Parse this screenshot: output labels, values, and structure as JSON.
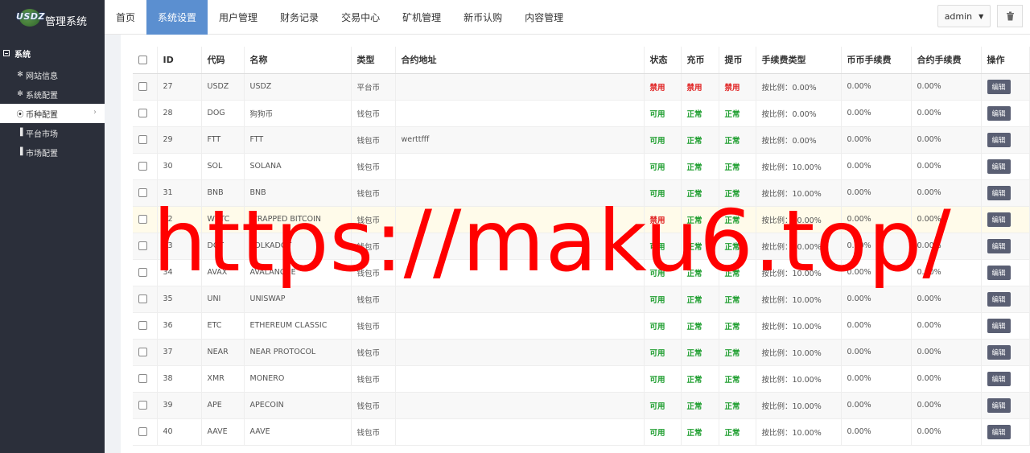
{
  "app": {
    "logo_text": "USDZ",
    "title": "管理系统"
  },
  "sidebar": {
    "group": "系统",
    "items": [
      {
        "label": "网站信息",
        "icon": "gear-icon"
      },
      {
        "label": "系统配置",
        "icon": "gear-icon"
      },
      {
        "label": "币种配置",
        "icon": "circle-dot-icon",
        "active": true
      },
      {
        "label": "平台市场",
        "icon": "bar-chart-icon"
      },
      {
        "label": "市场配置",
        "icon": "bar-chart-icon"
      }
    ]
  },
  "topnav": {
    "items": [
      {
        "label": "首页"
      },
      {
        "label": "系统设置",
        "active": true
      },
      {
        "label": "用户管理"
      },
      {
        "label": "财务记录"
      },
      {
        "label": "交易中心"
      },
      {
        "label": "矿机管理"
      },
      {
        "label": "新币认购"
      },
      {
        "label": "内容管理"
      }
    ],
    "user": "admin"
  },
  "table": {
    "headers": [
      "ID",
      "代码",
      "名称",
      "类型",
      "合约地址",
      "状态",
      "充币",
      "提币",
      "手续费类型",
      "币币手续费",
      "合约手续费",
      "操作"
    ],
    "edit_label": "编辑",
    "rows": [
      {
        "id": "27",
        "code": "USDZ",
        "name": "USDZ",
        "type": "平台币",
        "contract": "",
        "status": "禁用",
        "deposit": "禁用",
        "withdraw": "禁用",
        "fee_type": "按比例：0.00%",
        "spot_fee": "0.00%",
        "contract_fee": "0.00%"
      },
      {
        "id": "28",
        "code": "DOG",
        "name": "狗狗币",
        "type": "钱包币",
        "contract": "",
        "status": "可用",
        "deposit": "正常",
        "withdraw": "正常",
        "fee_type": "按比例：0.00%",
        "spot_fee": "0.00%",
        "contract_fee": "0.00%"
      },
      {
        "id": "29",
        "code": "FTT",
        "name": "FTT",
        "type": "钱包币",
        "contract": "werttfff",
        "status": "可用",
        "deposit": "正常",
        "withdraw": "正常",
        "fee_type": "按比例：0.00%",
        "spot_fee": "0.00%",
        "contract_fee": "0.00%"
      },
      {
        "id": "30",
        "code": "SOL",
        "name": "SOLANA",
        "type": "钱包币",
        "contract": "",
        "status": "可用",
        "deposit": "正常",
        "withdraw": "正常",
        "fee_type": "按比例：10.00%",
        "spot_fee": "0.00%",
        "contract_fee": "0.00%"
      },
      {
        "id": "31",
        "code": "BNB",
        "name": "BNB",
        "type": "钱包币",
        "contract": "",
        "status": "可用",
        "deposit": "正常",
        "withdraw": "正常",
        "fee_type": "按比例：10.00%",
        "spot_fee": "0.00%",
        "contract_fee": "0.00%"
      },
      {
        "id": "32",
        "code": "WBTC",
        "name": "WRAPPED BITCOIN",
        "type": "钱包币",
        "contract": "",
        "status": "禁用",
        "deposit": "正常",
        "withdraw": "正常",
        "fee_type": "按比例：10.00%",
        "spot_fee": "0.00%",
        "contract_fee": "0.00%"
      },
      {
        "id": "33",
        "code": "DOT",
        "name": "POLKADOT",
        "type": "钱包币",
        "contract": "",
        "status": "可用",
        "deposit": "正常",
        "withdraw": "正常",
        "fee_type": "按比例：10.00%",
        "spot_fee": "0.00%",
        "contract_fee": "0.00%"
      },
      {
        "id": "34",
        "code": "AVAX",
        "name": "AVALANCHE",
        "type": "钱包币",
        "contract": "",
        "status": "可用",
        "deposit": "正常",
        "withdraw": "正常",
        "fee_type": "按比例：10.00%",
        "spot_fee": "0.00%",
        "contract_fee": "0.00%"
      },
      {
        "id": "35",
        "code": "UNI",
        "name": "UNISWAP",
        "type": "钱包币",
        "contract": "",
        "status": "可用",
        "deposit": "正常",
        "withdraw": "正常",
        "fee_type": "按比例：10.00%",
        "spot_fee": "0.00%",
        "contract_fee": "0.00%"
      },
      {
        "id": "36",
        "code": "ETC",
        "name": "ETHEREUM CLASSIC",
        "type": "钱包币",
        "contract": "",
        "status": "可用",
        "deposit": "正常",
        "withdraw": "正常",
        "fee_type": "按比例：10.00%",
        "spot_fee": "0.00%",
        "contract_fee": "0.00%"
      },
      {
        "id": "37",
        "code": "NEAR",
        "name": "NEAR PROTOCOL",
        "type": "钱包币",
        "contract": "",
        "status": "可用",
        "deposit": "正常",
        "withdraw": "正常",
        "fee_type": "按比例：10.00%",
        "spot_fee": "0.00%",
        "contract_fee": "0.00%"
      },
      {
        "id": "38",
        "code": "XMR",
        "name": "MONERO",
        "type": "钱包币",
        "contract": "",
        "status": "可用",
        "deposit": "正常",
        "withdraw": "正常",
        "fee_type": "按比例：10.00%",
        "spot_fee": "0.00%",
        "contract_fee": "0.00%"
      },
      {
        "id": "39",
        "code": "APE",
        "name": "APECOIN",
        "type": "钱包币",
        "contract": "",
        "status": "可用",
        "deposit": "正常",
        "withdraw": "正常",
        "fee_type": "按比例：10.00%",
        "spot_fee": "0.00%",
        "contract_fee": "0.00%"
      },
      {
        "id": "40",
        "code": "AAVE",
        "name": "AAVE",
        "type": "钱包币",
        "contract": "",
        "status": "可用",
        "deposit": "正常",
        "withdraw": "正常",
        "fee_type": "按比例：10.00%",
        "spot_fee": "0.00%",
        "contract_fee": "0.00%"
      }
    ]
  },
  "watermark": "https://maku6.top/",
  "colors": {
    "nav_active": "#5b8fd0",
    "sidebar_bg": "#2b2f3a",
    "status_green": "#1e9e2f",
    "status_red": "#e02020",
    "watermark": "#ff0000"
  }
}
